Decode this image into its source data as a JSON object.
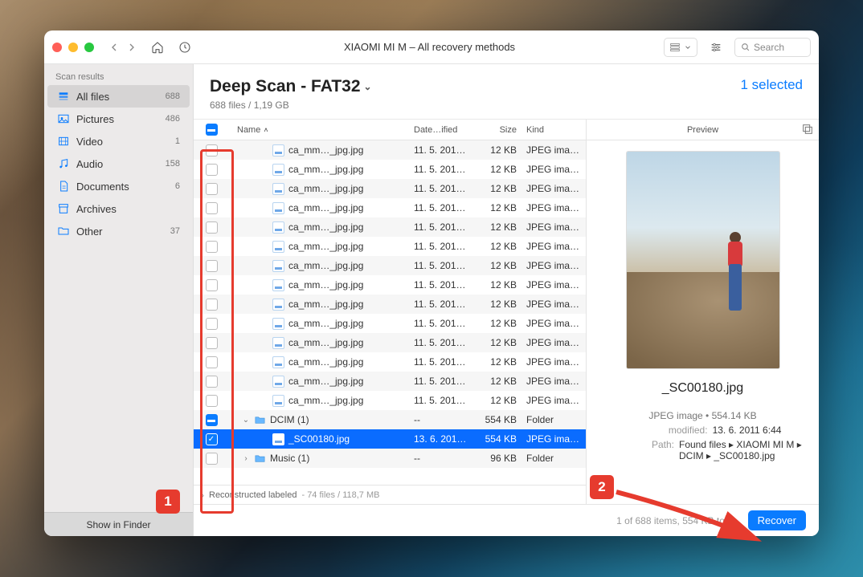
{
  "window_title": "XIAOMI MI M – All recovery methods",
  "search_placeholder": "Search",
  "sidebar": {
    "header": "Scan results",
    "items": [
      {
        "label": "All files",
        "count": "688",
        "active": true,
        "icon": "stack"
      },
      {
        "label": "Pictures",
        "count": "486",
        "icon": "image"
      },
      {
        "label": "Video",
        "count": "1",
        "icon": "film"
      },
      {
        "label": "Audio",
        "count": "158",
        "icon": "music"
      },
      {
        "label": "Documents",
        "count": "6",
        "icon": "doc"
      },
      {
        "label": "Archives",
        "count": "",
        "icon": "archive"
      },
      {
        "label": "Other",
        "count": "37",
        "icon": "folder"
      }
    ],
    "footer": "Show in Finder"
  },
  "main": {
    "title": "Deep Scan - FAT32",
    "subtitle": "688 files / 1,19 GB",
    "selected_text": "1 selected"
  },
  "columns": {
    "name": "Name",
    "date": "Date…ified",
    "size": "Size",
    "kind": "Kind"
  },
  "files": [
    {
      "check": false,
      "type": "jpg",
      "name": "ca_mm…_jpg.jpg",
      "date": "11. 5. 201…",
      "size": "12 KB",
      "kind": "JPEG ima…",
      "depth": "depth0"
    },
    {
      "check": false,
      "type": "jpg",
      "name": "ca_mm…_jpg.jpg",
      "date": "11. 5. 201…",
      "size": "12 KB",
      "kind": "JPEG ima…",
      "depth": "depth0"
    },
    {
      "check": false,
      "type": "jpg",
      "name": "ca_mm…_jpg.jpg",
      "date": "11. 5. 201…",
      "size": "12 KB",
      "kind": "JPEG ima…",
      "depth": "depth0"
    },
    {
      "check": false,
      "type": "jpg",
      "name": "ca_mm…_jpg.jpg",
      "date": "11. 5. 201…",
      "size": "12 KB",
      "kind": "JPEG ima…",
      "depth": "depth0"
    },
    {
      "check": false,
      "type": "jpg",
      "name": "ca_mm…_jpg.jpg",
      "date": "11. 5. 201…",
      "size": "12 KB",
      "kind": "JPEG ima…",
      "depth": "depth0"
    },
    {
      "check": false,
      "type": "jpg",
      "name": "ca_mm…_jpg.jpg",
      "date": "11. 5. 201…",
      "size": "12 KB",
      "kind": "JPEG ima…",
      "depth": "depth0"
    },
    {
      "check": false,
      "type": "jpg",
      "name": "ca_mm…_jpg.jpg",
      "date": "11. 5. 201…",
      "size": "12 KB",
      "kind": "JPEG ima…",
      "depth": "depth0"
    },
    {
      "check": false,
      "type": "jpg",
      "name": "ca_mm…_jpg.jpg",
      "date": "11. 5. 201…",
      "size": "12 KB",
      "kind": "JPEG ima…",
      "depth": "depth0"
    },
    {
      "check": false,
      "type": "jpg",
      "name": "ca_mm…_jpg.jpg",
      "date": "11. 5. 201…",
      "size": "12 KB",
      "kind": "JPEG ima…",
      "depth": "depth0"
    },
    {
      "check": false,
      "type": "jpg",
      "name": "ca_mm…_jpg.jpg",
      "date": "11. 5. 201…",
      "size": "12 KB",
      "kind": "JPEG ima…",
      "depth": "depth0"
    },
    {
      "check": false,
      "type": "jpg",
      "name": "ca_mm…_jpg.jpg",
      "date": "11. 5. 201…",
      "size": "12 KB",
      "kind": "JPEG ima…",
      "depth": "depth0"
    },
    {
      "check": false,
      "type": "jpg",
      "name": "ca_mm…_jpg.jpg",
      "date": "11. 5. 201…",
      "size": "12 KB",
      "kind": "JPEG ima…",
      "depth": "depth0"
    },
    {
      "check": false,
      "type": "jpg",
      "name": "ca_mm…_jpg.jpg",
      "date": "11. 5. 201…",
      "size": "12 KB",
      "kind": "JPEG ima…",
      "depth": "depth0"
    },
    {
      "check": false,
      "type": "jpg",
      "name": "ca_mm…_jpg.jpg",
      "date": "11. 5. 201…",
      "size": "12 KB",
      "kind": "JPEG ima…",
      "depth": "depth0"
    },
    {
      "check": "semi",
      "type": "folder",
      "name": "DCIM (1)",
      "date": "--",
      "size": "554 KB",
      "kind": "Folder",
      "depth": "depth-folder",
      "disclosure": "down"
    },
    {
      "check": true,
      "type": "jpg",
      "name": "_SC00180.jpg",
      "date": "13. 6. 201…",
      "size": "554 KB",
      "kind": "JPEG ima…",
      "depth": "depth1",
      "selected": true
    },
    {
      "check": false,
      "type": "folder",
      "name": "Music (1)",
      "date": "--",
      "size": "96 KB",
      "kind": "Folder",
      "depth": "depth-folder",
      "disclosure": "right"
    }
  ],
  "list_footer": {
    "label": "Reconstructed labeled",
    "detail": "- 74 files / 118,7 MB"
  },
  "preview": {
    "header": "Preview",
    "filename": "_SC00180.jpg",
    "meta": "JPEG image • 554.14 KB",
    "modified_label": "modified:",
    "modified_value": "13. 6. 2011 6:44",
    "path_label": "Path:",
    "path_value": "Found files ▸ XIAOMI MI M ▸ DCIM ▸ _SC00180.jpg"
  },
  "bottom": {
    "status": "1 of 688 items, 554 KB total",
    "recover": "Recover"
  },
  "annotations": {
    "one": "1",
    "two": "2"
  }
}
